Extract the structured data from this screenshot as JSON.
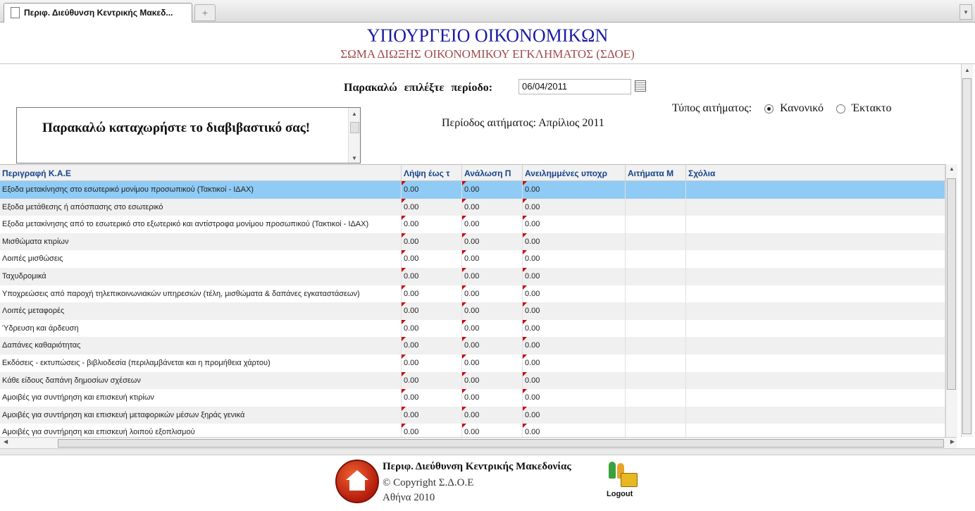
{
  "browser": {
    "tab_title": "Περιφ. Διεύθυνση Κεντρικής Μακεδ...",
    "new_tab_label": "+",
    "tab_menu_label": "▾"
  },
  "header": {
    "ministry": "ΥΠΟΥΡΓΕΙΟ ΟΙΚΟΝΟΜΙΚΩΝ",
    "agency": "ΣΩΜΑ ΔΙΩΞΗΣ ΟΙΚΟΝΟΜΙΚΟΥ ΕΓΚΛΗΜΑΤΟΣ (ΣΔΟΕ)"
  },
  "form": {
    "period_label": "Παρακαλώ επιλέξτε περίοδο:",
    "period_value": "06/04/2011",
    "note_text": "Παρακαλώ καταχωρήστε το διαβιβαστικό σας!",
    "request_period_text": "Περίοδος αιτήματος: Απρίλιος 2011",
    "request_type_label": "Τύπος αιτήματος:",
    "request_type_options": [
      "Κανονικό",
      "Έκτακτο"
    ],
    "request_type_selected": "Κανονικό"
  },
  "grid": {
    "columns": [
      "Περιγραφή Κ.Α.Ε",
      "Λήψη έως τ",
      "Ανάλωση Π",
      "Ανειλημμένες υποχρ",
      "Αιτήματα Μ",
      "Σχόλια"
    ],
    "rows": [
      {
        "desc": "Εξοδα μετακίνησης στο εσωτερικό μονίμου προσωπικού (Τακτικοί - ΙΔΑΧ)",
        "v1": "0.00",
        "v2": "0.00",
        "v3": "0.00"
      },
      {
        "desc": "Εξοδα μετάθεσης ή απόσπασης στο εσωτερικό",
        "v1": "0.00",
        "v2": "0.00",
        "v3": "0.00"
      },
      {
        "desc": "Εξοδα μετακίνησης από το εσωτερικό στο εξωτερικό και αντίστροφα μονίμου προσωπικού (Τακτικοί - ΙΔΑΧ)",
        "v1": "0.00",
        "v2": "0.00",
        "v3": "0.00"
      },
      {
        "desc": "Μισθώματα κτιρίων",
        "v1": "0.00",
        "v2": "0.00",
        "v3": "0.00"
      },
      {
        "desc": "Λοιπές μισθώσεις",
        "v1": "0.00",
        "v2": "0.00",
        "v3": "0.00"
      },
      {
        "desc": "Ταχυδρομικά",
        "v1": "0.00",
        "v2": "0.00",
        "v3": "0.00"
      },
      {
        "desc": "Υποχρεώσεις από παροχή τηλεπικοινωνιακών υπηρεσιών (τέλη, μισθώματα & δαπάνες εγκαταστάσεων)",
        "v1": "0.00",
        "v2": "0.00",
        "v3": "0.00"
      },
      {
        "desc": "Λοιπές μεταφορές",
        "v1": "0.00",
        "v2": "0.00",
        "v3": "0.00"
      },
      {
        "desc": "Ύδρευση και άρδευση",
        "v1": "0.00",
        "v2": "0.00",
        "v3": "0.00"
      },
      {
        "desc": "Δαπάνες καθαριότητας",
        "v1": "0.00",
        "v2": "0.00",
        "v3": "0.00"
      },
      {
        "desc": "Εκδόσεις - εκτυπώσεις - βιβλιοδεσία (περιλαμβάνεται και η προμήθεια χάρτου)",
        "v1": "0.00",
        "v2": "0.00",
        "v3": "0.00"
      },
      {
        "desc": "Κάθε είδους δαπάνη δημοσίων σχέσεων",
        "v1": "0.00",
        "v2": "0.00",
        "v3": "0.00"
      },
      {
        "desc": "Αμοιβές για συντήρηση και επισκευή κτιρίων",
        "v1": "0.00",
        "v2": "0.00",
        "v3": "0.00"
      },
      {
        "desc": "Αμοιβές για συντήρηση και επισκευή μεταφορικών μέσων ξηράς γενικά",
        "v1": "0.00",
        "v2": "0.00",
        "v3": "0.00"
      },
      {
        "desc": "Αμοιβές για συντήρηση και επισκευή λοιπού εξοπλισμού",
        "v1": "0.00",
        "v2": "0.00",
        "v3": "0.00"
      }
    ],
    "selected_row": 0
  },
  "footer": {
    "line1": "Περιφ. Διεύθυνση Κεντρικής Μακεδονίας",
    "line2": "© Copyright Σ.Δ.Ο.Ε",
    "line3": "Αθήνα 2010",
    "logout_label": "Logout"
  },
  "icons": {
    "home": "home-icon",
    "logout": "logout-lock-icon",
    "calendar": "calendar-icon"
  },
  "colors": {
    "ministry_title": "#1a1aa6",
    "agency_title": "#a04a4a",
    "selected_row": "#8fcbf5",
    "grid_header_text": "#15428b"
  }
}
